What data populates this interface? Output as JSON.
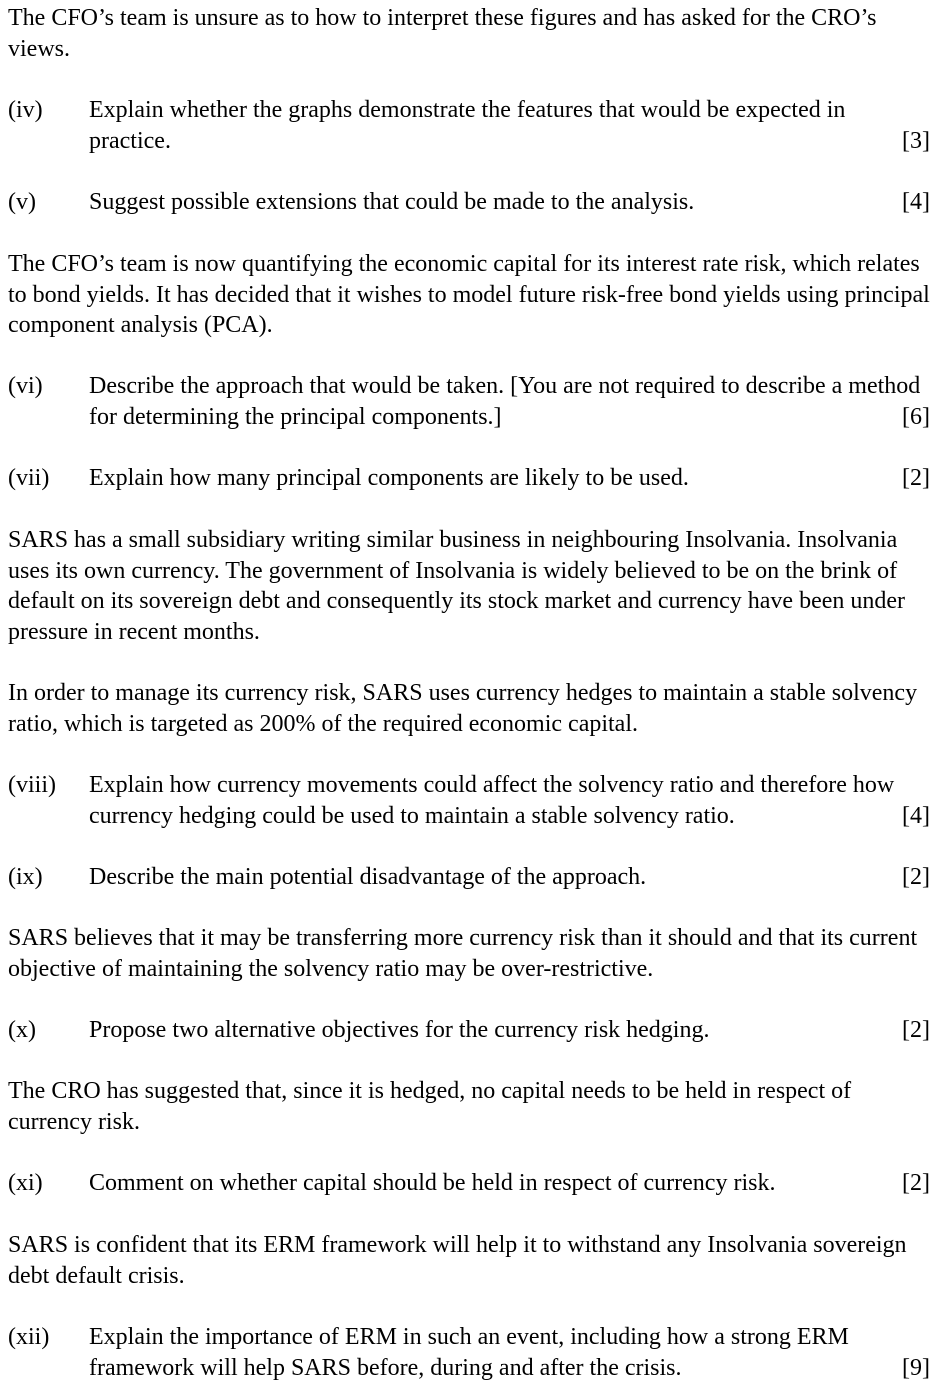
{
  "document": {
    "blocks": [
      {
        "type": "para",
        "text": "The CFO’s team is unsure as to how to interpret these figures and has asked for the CRO’s views."
      },
      {
        "type": "question",
        "number": "(iv)",
        "text": "Explain whether the graphs demonstrate the features that would be expected in practice.",
        "marks": "[3]"
      },
      {
        "type": "question",
        "number": "(v)",
        "text": "Suggest possible extensions that could be made to the analysis.",
        "marks": "[4]"
      },
      {
        "type": "para",
        "text": "The CFO’s team is now quantifying the economic capital for its interest rate risk, which relates to bond yields.  It has decided that it wishes to model future risk-free bond yields using principal component analysis (PCA)."
      },
      {
        "type": "question",
        "number": "(vi)",
        "text": "Describe the approach that would be taken.  [You are not required to describe a method for determining the principal components.]",
        "marks": "[6]"
      },
      {
        "type": "question",
        "number": "(vii)",
        "text": "Explain how many principal components are likely to be used.",
        "marks": "[2]"
      },
      {
        "type": "para",
        "text": "SARS has a small subsidiary writing similar business in neighbouring Insolvania. Insolvania uses its own currency.  The government of Insolvania is widely believed to be on the brink of default on its sovereign debt and consequently its stock market and currency have been under pressure in recent months."
      },
      {
        "type": "para",
        "text": "In order to manage its currency risk, SARS uses currency hedges to maintain a stable solvency ratio, which is targeted as 200% of the required economic capital."
      },
      {
        "type": "question",
        "number": "(viii)",
        "text": "Explain how currency movements could affect the solvency ratio and therefore how currency hedging could be used to maintain a stable solvency ratio.",
        "marks": "[4]"
      },
      {
        "type": "question",
        "number": "(ix)",
        "text": "Describe the main potential disadvantage of the approach.",
        "marks": "[2]"
      },
      {
        "type": "para",
        "text": "SARS believes that it may be transferring more currency risk than it should and that its current objective of maintaining the solvency ratio may be over-restrictive."
      },
      {
        "type": "question",
        "number": "(x)",
        "text": "Propose two alternative objectives for the currency risk hedging.",
        "marks": "[2]"
      },
      {
        "type": "para",
        "text": "The CRO has suggested that, since it is hedged, no capital needs to be held in respect of currency risk."
      },
      {
        "type": "question",
        "number": "(xi)",
        "text": "Comment on whether capital should be held in respect of currency risk.",
        "marks": "[2]"
      },
      {
        "type": "para",
        "text": "SARS is confident that its ERM framework will help it to withstand any Insolvania sovereign debt default crisis."
      },
      {
        "type": "question",
        "number": "(xii)",
        "text": "Explain the importance of ERM in such an event, including how a strong ERM framework will help SARS before, during and after the crisis.",
        "marks": "[9]"
      }
    ]
  }
}
